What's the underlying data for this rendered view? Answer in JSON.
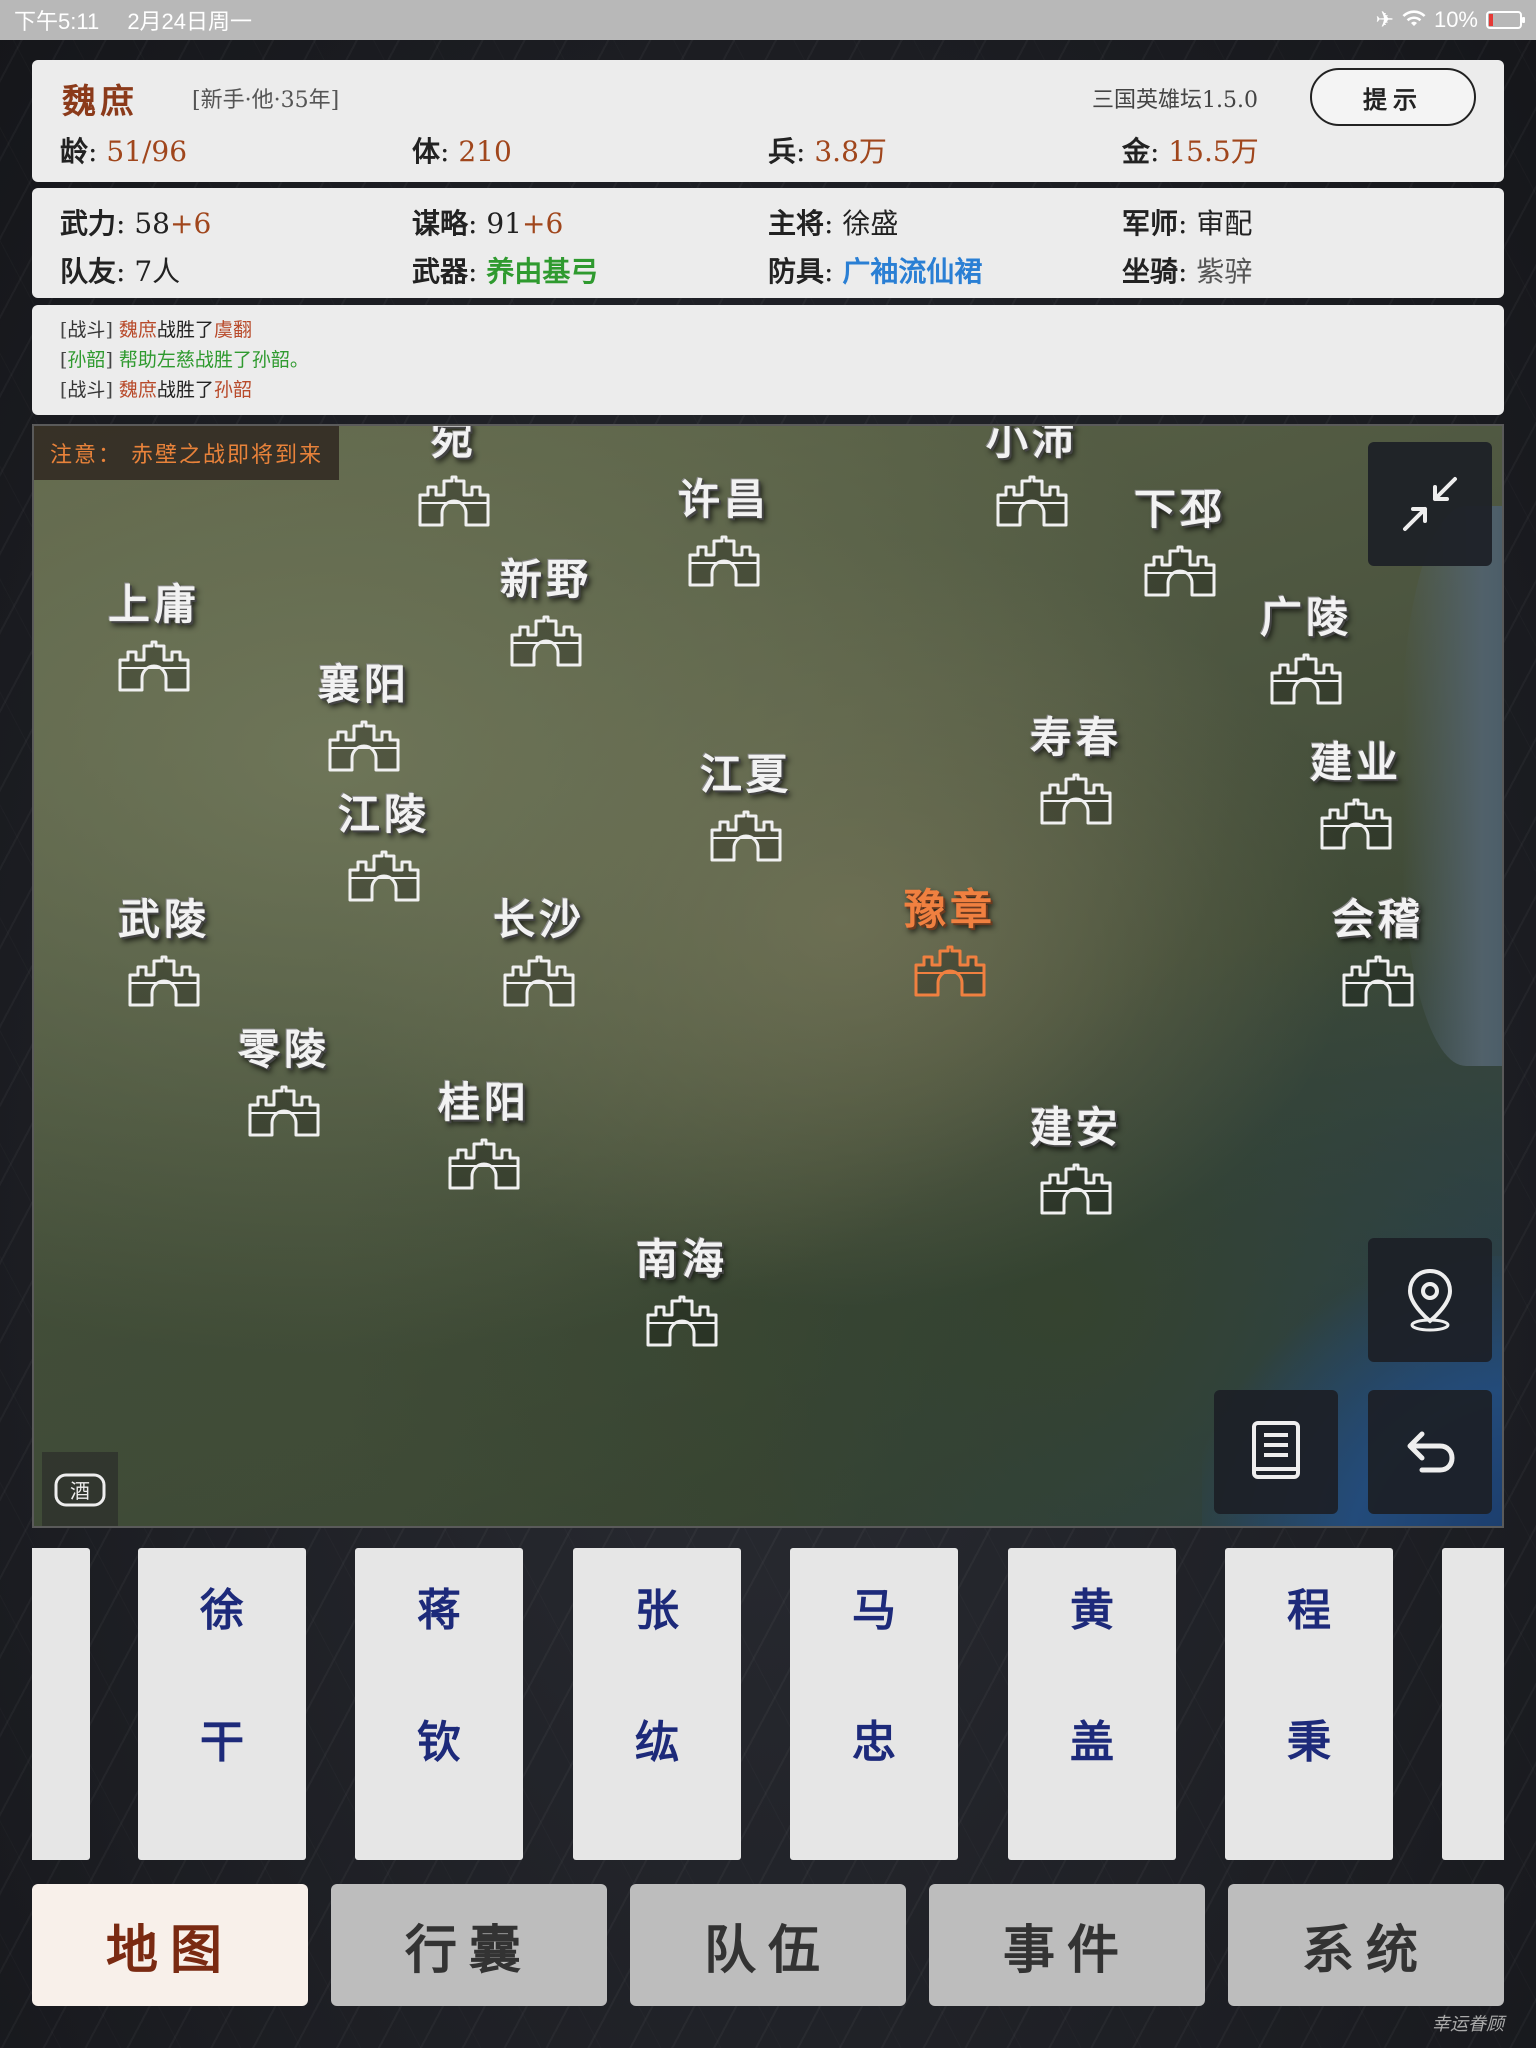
{
  "status_bar": {
    "time": "下午5:11",
    "date": "2月24日周一",
    "battery": "10%"
  },
  "hero": {
    "name": "魏庶",
    "tag": "[新手·他·35年]",
    "version": "三国英雄坛1.5.0",
    "hint_label": "提示"
  },
  "stats_top": {
    "age_k": "龄",
    "age_v": "51/96",
    "body_k": "体",
    "body_v": "210",
    "troops_k": "兵",
    "troops_v": "3.8万",
    "gold_k": "金",
    "gold_v": "15.5万"
  },
  "stats_mid": {
    "force_k": "武力",
    "force_v": "58",
    "force_plus": "+6",
    "strategy_k": "谋略",
    "strategy_v": "91",
    "strategy_plus": "+6",
    "general_k": "主将",
    "general_v": "徐盛",
    "advisor_k": "军师",
    "advisor_v": "审配",
    "mates_k": "队友",
    "mates_v": "7人",
    "weapon_k": "武器",
    "weapon_v": "养由基弓",
    "armor_k": "防具",
    "armor_v": "广袖流仙裙",
    "mount_k": "坐骑",
    "mount_v": "紫骍"
  },
  "logs": [
    {
      "tag": "战斗",
      "a": "魏庶",
      "b": "战胜了",
      "c": "虞翻"
    },
    {
      "tag": "孙韶",
      "text": "帮助左慈战胜了孙韶。"
    },
    {
      "tag": "战斗",
      "a": "魏庶",
      "b": "战胜了",
      "c": "孙韶"
    }
  ],
  "map": {
    "notice": "注意： 赤壁之战即将到来",
    "wine_label": "酒",
    "cities": [
      {
        "name": "宛"
      },
      {
        "name": "许昌"
      },
      {
        "name": "小沛"
      },
      {
        "name": "下邳"
      },
      {
        "name": "新野"
      },
      {
        "name": "上庸"
      },
      {
        "name": "广陵"
      },
      {
        "name": "襄阳"
      },
      {
        "name": "寿春"
      },
      {
        "name": "江夏"
      },
      {
        "name": "建业"
      },
      {
        "name": "江陵"
      },
      {
        "name": "武陵"
      },
      {
        "name": "长沙"
      },
      {
        "name": "豫章",
        "active": true
      },
      {
        "name": "会稽"
      },
      {
        "name": "零陵"
      },
      {
        "name": "桂阳"
      },
      {
        "name": "建安"
      },
      {
        "name": "南海"
      }
    ]
  },
  "characters": [
    {
      "c1": "徐",
      "c2": "干"
    },
    {
      "c1": "蒋",
      "c2": "钦"
    },
    {
      "c1": "张",
      "c2": "纮"
    },
    {
      "c1": "马",
      "c2": "忠"
    },
    {
      "c1": "黄",
      "c2": "盖"
    },
    {
      "c1": "程",
      "c2": "秉"
    }
  ],
  "tabs": [
    "地图",
    "行囊",
    "队伍",
    "事件",
    "系统"
  ],
  "signature": "幸运眷顾",
  "colors": {
    "accent": "#8b3a1a",
    "highlight_city": "#f08040",
    "panel": "#ececec",
    "tab_active": "#f8f0ea"
  }
}
